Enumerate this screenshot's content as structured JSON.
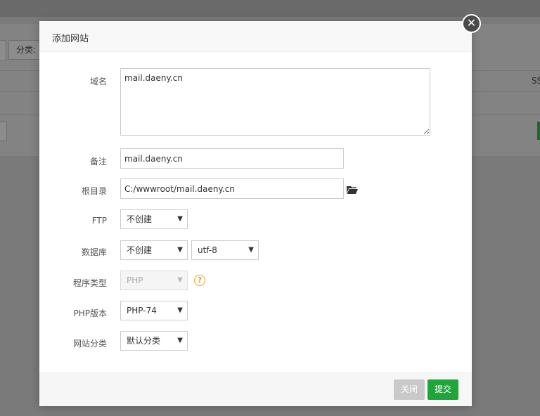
{
  "background": {
    "filter_label": "分类: ",
    "column_ss": "SS"
  },
  "dialog": {
    "title": "添加网站",
    "close_glyph": "✕",
    "fields": {
      "domain": {
        "label": "域名",
        "value": "mail.daeny.cn"
      },
      "remark": {
        "label": "备注",
        "value": "mail.daeny.cn"
      },
      "root_dir": {
        "label": "根目录",
        "value": "C:/wwwroot/mail.daeny.cn"
      },
      "ftp": {
        "label": "FTP",
        "value": "不创建"
      },
      "database": {
        "label": "数据库",
        "value": "不创建",
        "charset": "utf-8"
      },
      "program_type": {
        "label": "程序类型",
        "value": "PHP",
        "help_glyph": "?"
      },
      "php_version": {
        "label": "PHP版本",
        "value": "PHP-74"
      },
      "site_category": {
        "label": "网站分类",
        "value": "默认分类"
      }
    },
    "buttons": {
      "close": "关闭",
      "submit": "提交"
    }
  },
  "colors": {
    "submit": "#20a53a",
    "close_disabled": "#c9c9c9",
    "help": "#f0a020"
  }
}
